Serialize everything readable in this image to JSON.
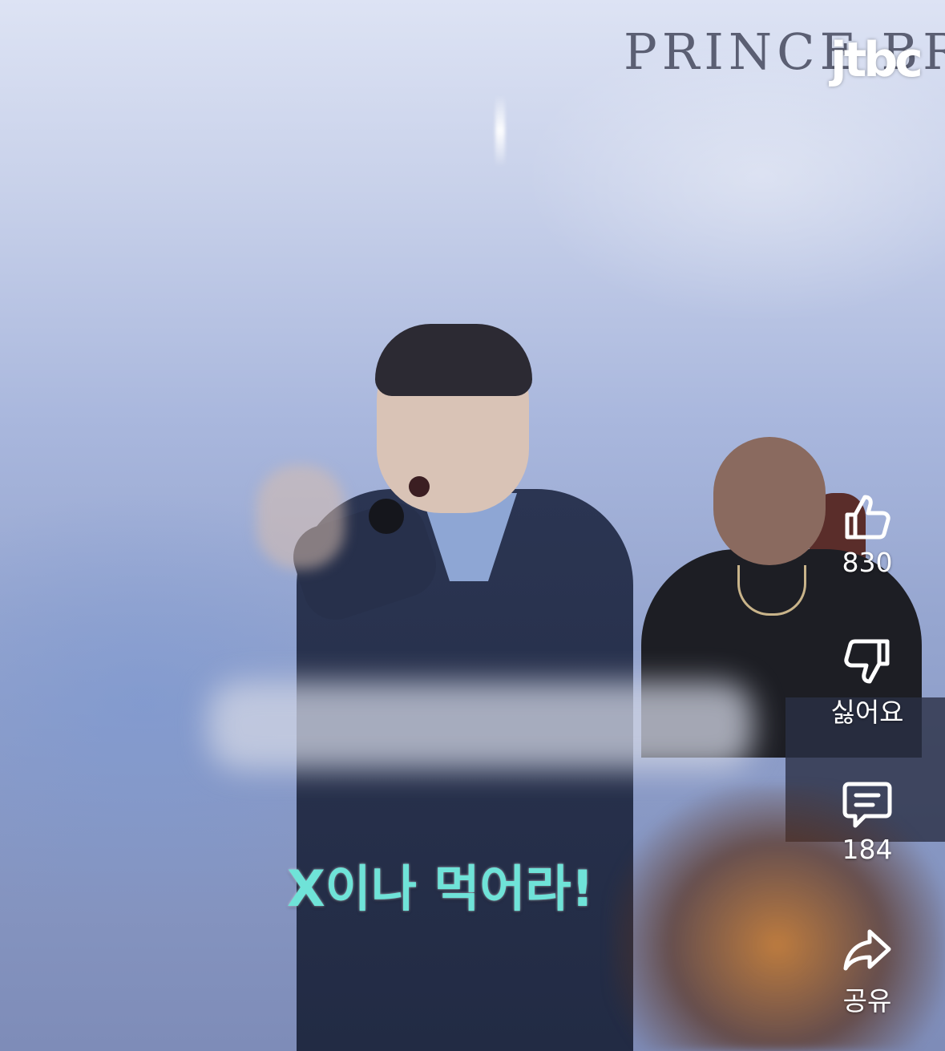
{
  "video": {
    "background_sign": "PRINCE BR",
    "channel_logo": "jtbc",
    "caption": "X이나 먹어라!",
    "caption_color": "#6fe3d8"
  },
  "actions": {
    "like": {
      "icon": "thumbs-up-icon",
      "label": "830"
    },
    "dislike": {
      "icon": "thumbs-down-icon",
      "label": "싫어요"
    },
    "comments": {
      "icon": "comment-icon",
      "label": "184"
    },
    "share": {
      "icon": "share-icon",
      "label": "공유"
    }
  }
}
